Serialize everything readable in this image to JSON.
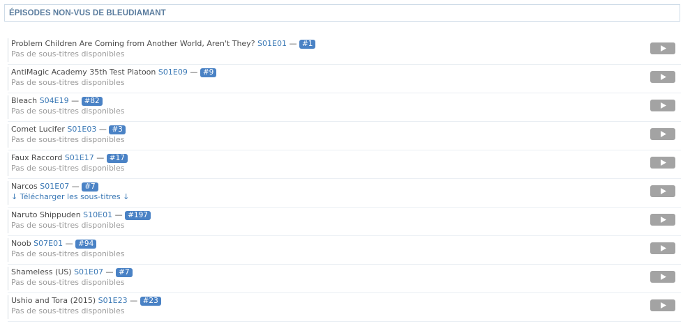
{
  "panel": {
    "title": "ÉPISODES NON-VUS DE BLEUDIAMANT"
  },
  "episodes": [
    {
      "show": "Problem Children Are Coming from Another World, Aren't They?",
      "code": "S01E01",
      "separator": "—",
      "number": "#1",
      "subtitle": "Pas de sous-titres disponibles",
      "subtitle_is_link": false
    },
    {
      "show": "AntiMagic Academy 35th Test Platoon",
      "code": "S01E09",
      "separator": "—",
      "number": "#9",
      "subtitle": "Pas de sous-titres disponibles",
      "subtitle_is_link": false
    },
    {
      "show": "Bleach",
      "code": "S04E19",
      "separator": "—",
      "number": "#82",
      "subtitle": "Pas de sous-titres disponibles",
      "subtitle_is_link": false
    },
    {
      "show": "Comet Lucifer",
      "code": "S01E03",
      "separator": "—",
      "number": "#3",
      "subtitle": "Pas de sous-titres disponibles",
      "subtitle_is_link": false
    },
    {
      "show": "Faux Raccord",
      "code": "S01E17",
      "separator": "—",
      "number": "#17",
      "subtitle": "Pas de sous-titres disponibles",
      "subtitle_is_link": false
    },
    {
      "show": "Narcos",
      "code": "S01E07",
      "separator": "—",
      "number": "#7",
      "subtitle": "↓ Télécharger les sous-titres ↓",
      "subtitle_is_link": true
    },
    {
      "show": "Naruto Shippuden",
      "code": "S10E01",
      "separator": "—",
      "number": "#197",
      "subtitle": "Pas de sous-titres disponibles",
      "subtitle_is_link": false
    },
    {
      "show": "Noob",
      "code": "S07E01",
      "separator": "—",
      "number": "#94",
      "subtitle": "Pas de sous-titres disponibles",
      "subtitle_is_link": false
    },
    {
      "show": "Shameless (US)",
      "code": "S01E07",
      "separator": "—",
      "number": "#7",
      "subtitle": "Pas de sous-titres disponibles",
      "subtitle_is_link": false
    },
    {
      "show": "Ushio and Tora (2015)",
      "code": "S01E23",
      "separator": "—",
      "number": "#23",
      "subtitle": "Pas de sous-titres disponibles",
      "subtitle_is_link": false
    }
  ],
  "icons": {
    "play": "play-icon"
  },
  "colors": {
    "accent": "#3a78b5",
    "badge_bg": "#4a82c5",
    "header_text": "#5a7c9e",
    "muted_text": "#9a9a9a",
    "play_button": "#a3a3a3"
  }
}
